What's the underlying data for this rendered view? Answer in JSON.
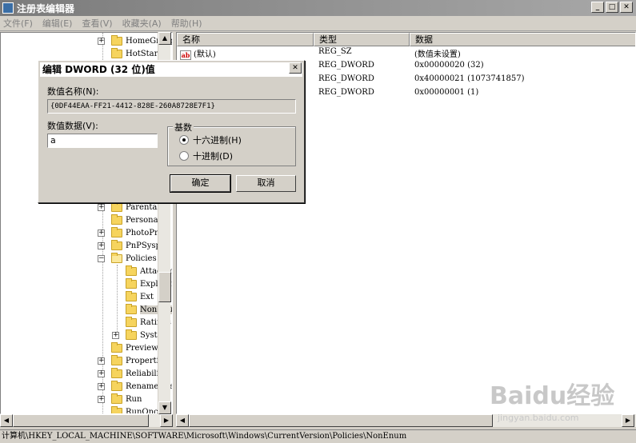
{
  "window": {
    "title": "注册表编辑器"
  },
  "menu": [
    "文件(F)",
    "编辑(E)",
    "查看(V)",
    "收藏夹(A)",
    "帮助(H)"
  ],
  "tree": {
    "top_items": [
      "HomeGroup",
      "HotStart"
    ],
    "items": [
      "Parental",
      "Personal",
      "PhotoPr",
      "PnPSysp",
      "Policies"
    ],
    "policies_children": [
      "Attachments",
      "Explorer",
      "Ext",
      "NonEnum",
      "Ratings",
      "System"
    ],
    "bottom_items": [
      "Preview",
      "Properties",
      "Reliability",
      "RenameFiles",
      "Run",
      "RunOnce"
    ]
  },
  "list": {
    "columns": [
      "名称",
      "类型",
      "数据"
    ],
    "rows": [
      {
        "name": "(默认)",
        "type": "REG_SZ",
        "data": "(数值未设置)"
      },
      {
        "name": "",
        "type": "REG_DWORD",
        "data": "0x00000020 (32)"
      },
      {
        "name": "",
        "type": "REG_DWORD",
        "data": "0x40000021 (1073741857)"
      },
      {
        "name": "",
        "type": "REG_DWORD",
        "data": "0x00000001 (1)"
      }
    ]
  },
  "dialog": {
    "title": "编辑 DWORD (32 位)值",
    "value_name_label": "数值名称(N):",
    "value_name": "{0DF44EAA-FF21-4412-828E-260A8728E7F1}",
    "value_data_label": "数值数据(V):",
    "value_data": "a",
    "base_label": "基数",
    "hex_label": "十六进制(H)",
    "dec_label": "十进制(D)",
    "ok_label": "确定",
    "cancel_label": "取消"
  },
  "status": "计算机\\HKEY_LOCAL_MACHINE\\SOFTWARE\\Microsoft\\Windows\\CurrentVersion\\Policies\\NonEnum",
  "watermark": {
    "logo": "Baidu经验",
    "url": "jingyan.baidu.com"
  }
}
